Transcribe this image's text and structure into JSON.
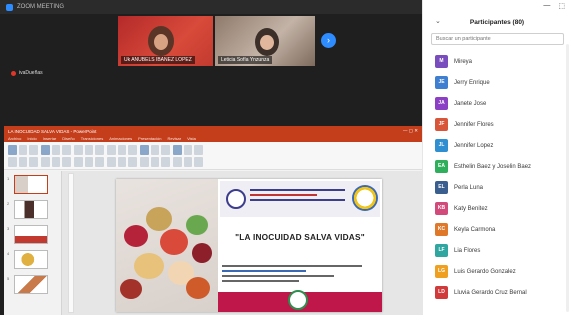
{
  "meeting": {
    "window_title": "ZOOM MEETING",
    "self_name": "ivaDueñas",
    "next_page_icon": "chevron-right"
  },
  "video_tiles": [
    {
      "name": "Uk ANUBELS IBANEZ LOPEZ"
    },
    {
      "name": "Leticia Sofía Ynzunza"
    }
  ],
  "presentation": {
    "window_title": "LA INOCUIDAD SALVA VIDAS - PowerPoint",
    "menu_tabs": [
      "Archivo",
      "Inicio",
      "Insertar",
      "Diseño",
      "Transiciones",
      "Animaciones",
      "Presentación",
      "Revisar",
      "Vista"
    ],
    "slide_count": 5,
    "selected_slide": 1,
    "slide": {
      "slogan": "\"LA INOCUIDAD SALVA VIDAS\""
    }
  },
  "participants": {
    "title": "Participantes (80)",
    "search_placeholder": "Buscar un participante",
    "colors": {
      "primary": "#2d8cff",
      "ppt": "#c43e1c"
    },
    "list": [
      {
        "initials": "M",
        "name": "Mireya",
        "color": "#7a4dbf"
      },
      {
        "initials": "JE",
        "name": "Jerry Enrique",
        "color": "#3f7fd1"
      },
      {
        "initials": "JA",
        "name": "Janete Jose",
        "color": "#8a3fc4"
      },
      {
        "initials": "JF",
        "name": "Jennifer Flores",
        "color": "#d9553a"
      },
      {
        "initials": "JL",
        "name": "Jennifer Lopez",
        "color": "#2f8fd1"
      },
      {
        "initials": "EA",
        "name": "Esthelin Baez y Joselin Baez",
        "color": "#2fae5c"
      },
      {
        "initials": "EL",
        "name": "Perla Luna",
        "color": "#3a5f8f"
      },
      {
        "initials": "KB",
        "name": "Katy Benitez",
        "color": "#d14a7a"
      },
      {
        "initials": "KC",
        "name": "Keyla Carmona",
        "color": "#e0782a"
      },
      {
        "initials": "LF",
        "name": "Lia Flores",
        "color": "#2fa6a0"
      },
      {
        "initials": "LG",
        "name": "Luis Gerardo Gonzalez",
        "color": "#f0a020"
      },
      {
        "initials": "LD",
        "name": "Lluvia Gerardo Cruz Bernal",
        "color": "#d13a3a"
      }
    ]
  }
}
